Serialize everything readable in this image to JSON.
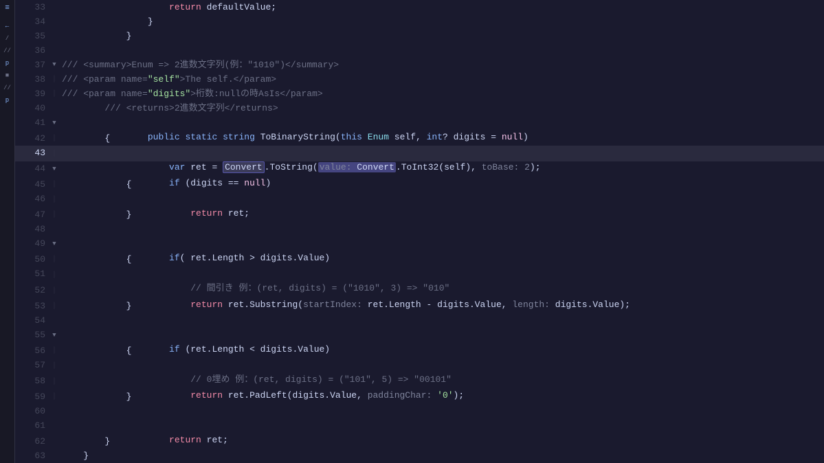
{
  "editor": {
    "background": "#1e1e2e",
    "lines": [
      {
        "num": 33,
        "fold": "",
        "indent": 4,
        "tokens": [
          {
            "t": "plain",
            "v": "                    return defaultValue;"
          }
        ]
      },
      {
        "num": 34,
        "fold": "",
        "indent": 4,
        "tokens": [
          {
            "t": "plain",
            "v": "                }"
          }
        ]
      },
      {
        "num": 35,
        "fold": "",
        "indent": 3,
        "tokens": [
          {
            "t": "plain",
            "v": "            }"
          }
        ]
      },
      {
        "num": 36,
        "fold": "",
        "indent": 0,
        "tokens": []
      },
      {
        "num": 37,
        "fold": "▼",
        "indent": 0,
        "tokens": [
          {
            "t": "comment",
            "v": "/// <summary>Enum =&gt; 2進数文字列(例：\"1010\")</summary>"
          }
        ]
      },
      {
        "num": 38,
        "fold": "",
        "indent": 0,
        "tokens": [
          {
            "t": "comment",
            "v": "/// <param name=\"self\">The self.</param>"
          }
        ]
      },
      {
        "num": 39,
        "fold": "",
        "indent": 0,
        "tokens": [
          {
            "t": "comment",
            "v": "/// <param name=\"digits\">桁数:nullの時AsIs</param>"
          }
        ]
      },
      {
        "num": 40,
        "fold": "",
        "indent": 0,
        "tokens": [
          {
            "t": "comment",
            "v": "/// <returns>2進数文字列</returns>"
          }
        ]
      },
      {
        "num": 41,
        "fold": "▼",
        "indent": 0,
        "tokens": [
          {
            "t": "plain",
            "v": "        public static string ToBinaryString(this Enum self, int? digits = null)"
          }
        ]
      },
      {
        "num": 42,
        "fold": "",
        "indent": 0,
        "tokens": [
          {
            "t": "plain",
            "v": "        {"
          }
        ]
      },
      {
        "num": 43,
        "fold": "",
        "indent": 0,
        "active": true,
        "tokens": [
          {
            "t": "plain",
            "v": "            var ret = "
          },
          {
            "t": "highlight",
            "v": "Convert"
          },
          {
            "t": "plain",
            "v": ".ToString("
          },
          {
            "t": "highlight-inner",
            "v": "value: Convert"
          },
          {
            "t": "plain",
            "v": ".ToInt32(self), "
          },
          {
            "t": "dim",
            "v": "toBase: 2"
          },
          {
            "t": "plain",
            "v": ");"
          }
        ]
      },
      {
        "num": 44,
        "fold": "▼",
        "indent": 0,
        "tokens": [
          {
            "t": "plain",
            "v": "            if (digits == null)"
          }
        ]
      },
      {
        "num": 45,
        "fold": "",
        "indent": 0,
        "tokens": [
          {
            "t": "plain",
            "v": "            {"
          }
        ]
      },
      {
        "num": 46,
        "fold": "",
        "indent": 0,
        "tokens": [
          {
            "t": "plain",
            "v": "                return ret;"
          }
        ]
      },
      {
        "num": 47,
        "fold": "",
        "indent": 0,
        "tokens": [
          {
            "t": "plain",
            "v": "            }"
          }
        ]
      },
      {
        "num": 48,
        "fold": "",
        "indent": 0,
        "tokens": []
      },
      {
        "num": 49,
        "fold": "▼",
        "indent": 0,
        "tokens": [
          {
            "t": "plain",
            "v": "            if( ret.Length > digits.Value)"
          }
        ]
      },
      {
        "num": 50,
        "fold": "",
        "indent": 0,
        "tokens": [
          {
            "t": "plain",
            "v": "            {"
          }
        ]
      },
      {
        "num": 51,
        "fold": "",
        "indent": 0,
        "tokens": [
          {
            "t": "comment",
            "v": "                // 間引き 例：(ret, digits) = (\"1010\", 3) => \"010\""
          }
        ]
      },
      {
        "num": 52,
        "fold": "",
        "indent": 0,
        "tokens": [
          {
            "t": "mixed52",
            "v": ""
          }
        ]
      },
      {
        "num": 53,
        "fold": "",
        "indent": 0,
        "tokens": [
          {
            "t": "plain",
            "v": "            }"
          }
        ]
      },
      {
        "num": 54,
        "fold": "",
        "indent": 0,
        "tokens": []
      },
      {
        "num": 55,
        "fold": "▼",
        "indent": 0,
        "tokens": [
          {
            "t": "plain",
            "v": "            if (ret.Length < digits.Value)"
          }
        ]
      },
      {
        "num": 56,
        "fold": "",
        "indent": 0,
        "tokens": [
          {
            "t": "plain",
            "v": "            {"
          }
        ]
      },
      {
        "num": 57,
        "fold": "",
        "indent": 0,
        "tokens": [
          {
            "t": "comment",
            "v": "                // 0埋め 例：(ret, digits) = (\"101\", 5) => \"00101\""
          }
        ]
      },
      {
        "num": 58,
        "fold": "",
        "indent": 0,
        "tokens": [
          {
            "t": "mixed58",
            "v": ""
          }
        ]
      },
      {
        "num": 59,
        "fold": "",
        "indent": 0,
        "tokens": [
          {
            "t": "plain",
            "v": "            }"
          }
        ]
      },
      {
        "num": 60,
        "fold": "",
        "indent": 0,
        "tokens": []
      },
      {
        "num": 61,
        "fold": "",
        "indent": 0,
        "tokens": [
          {
            "t": "plain",
            "v": "            return ret;"
          }
        ]
      },
      {
        "num": 62,
        "fold": "",
        "indent": 0,
        "tokens": [
          {
            "t": "plain",
            "v": "        }"
          }
        ]
      },
      {
        "num": 63,
        "fold": "",
        "indent": 0,
        "tokens": [
          {
            "t": "plain",
            "v": "    }"
          }
        ]
      }
    ]
  }
}
